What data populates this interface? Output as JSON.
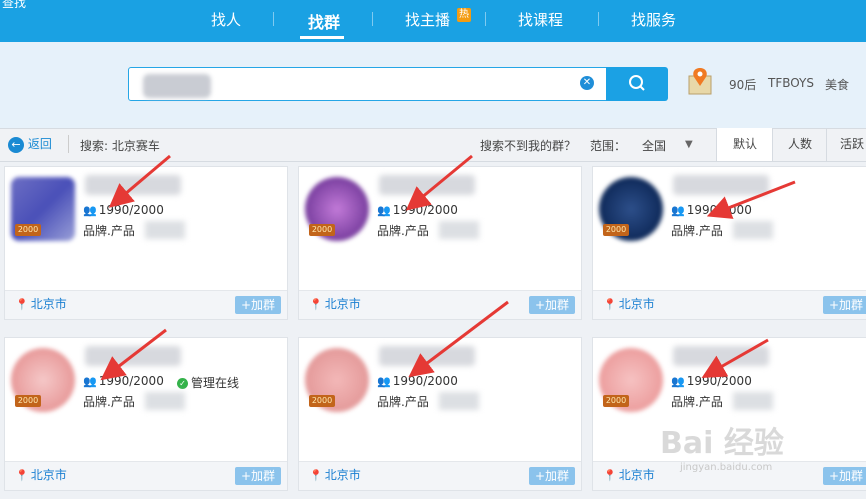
{
  "app": {
    "title": "查找"
  },
  "nav": {
    "items": [
      "找人",
      "找群",
      "找主播",
      "找课程",
      "找服务"
    ],
    "hot_badge": "热",
    "active": "找群"
  },
  "search": {
    "hot_tags": [
      "90后",
      "TFBOYS",
      "美食"
    ]
  },
  "filter": {
    "back_label": "返回",
    "search_label": "搜索: 北京赛车",
    "not_found_label": "搜索不到我的群？",
    "range_label": "范围：",
    "range_value": "全国",
    "sort_tabs": [
      "默认",
      "人数",
      "活跃"
    ]
  },
  "cards": [
    {
      "members": "1990/2000",
      "tags": "品牌.产品",
      "city": "北京市",
      "join_label": "+加群",
      "level": "2000"
    },
    {
      "members": "1990/2000",
      "tags": "品牌.产品",
      "city": "北京市",
      "join_label": "+加群",
      "level": "2000"
    },
    {
      "members": "1990/2000",
      "tags": "品牌.产品",
      "city": "北京市",
      "join_label": "+加群",
      "level": "2000"
    },
    {
      "members": "1990/2000",
      "tags": "品牌.产品",
      "city": "北京市",
      "join_label": "+加群",
      "level": "2000",
      "online": "管理在线"
    },
    {
      "members": "1990/2000",
      "tags": "品牌.产品",
      "city": "北京市",
      "join_label": "+加群",
      "level": "2000"
    },
    {
      "members": "1990/2000",
      "tags": "品牌.产品",
      "city": "北京市",
      "join_label": "+加群",
      "level": "2000"
    }
  ],
  "watermark": {
    "text": "Bai 经验",
    "url": "jingyan.baidu.com"
  },
  "colors": {
    "primary": "#1aa1e3",
    "arrow": "#e53935",
    "level_badge": "#c2641a"
  }
}
